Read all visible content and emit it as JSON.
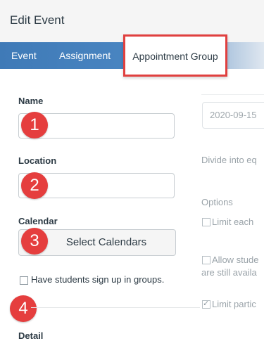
{
  "dialog": {
    "title": "Edit Event"
  },
  "tabs": [
    {
      "label": "Event"
    },
    {
      "label": "Assignment"
    },
    {
      "label": "Appointment Group"
    }
  ],
  "form": {
    "name_label": "Name",
    "location_label": "Location",
    "calendar_label": "Calendar",
    "select_calendars_label": "Select Calendars",
    "group_signup_label": "Have students sign up in groups.",
    "bottom_cut_label": "Detail"
  },
  "badges": [
    "1",
    "2",
    "3",
    "4"
  ],
  "right_panel": {
    "date_value": "2020-09-15",
    "divide_label": "Divide into eq",
    "options_label": "Options",
    "option_1": "Limit each",
    "option_2_line1": "Allow stude",
    "option_2_line2": "are still availa",
    "option_3": "Limit partic",
    "option_3_checked": true
  },
  "colors": {
    "tab_bar": "#4a86c2",
    "highlight_border": "#e0403f",
    "badge": "#e53e3e"
  }
}
